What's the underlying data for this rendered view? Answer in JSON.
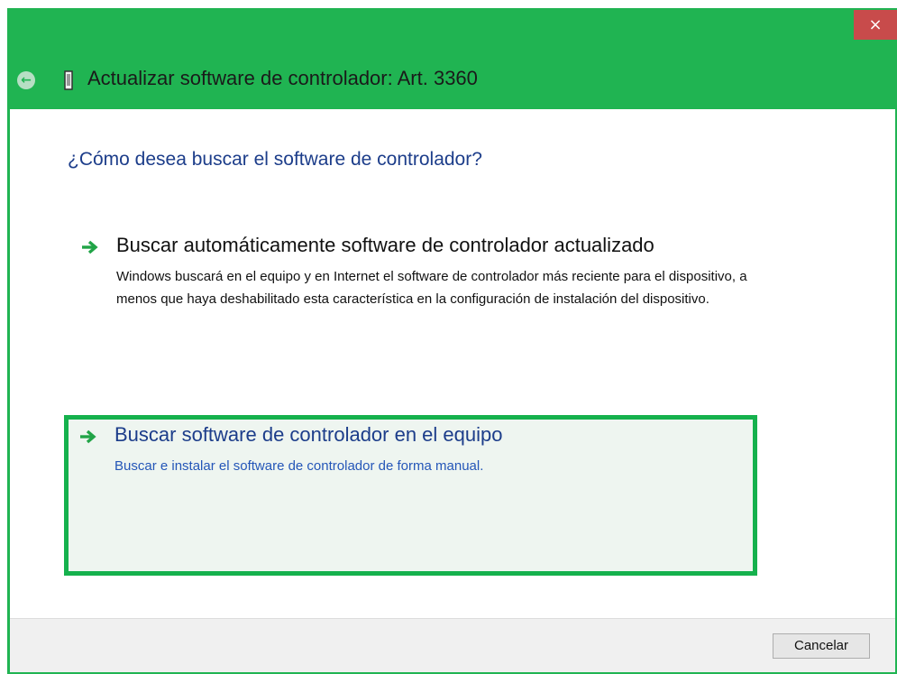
{
  "window": {
    "title": "Actualizar software de controlador: Art. 3360",
    "close_glyph": "×",
    "back_glyph": "←",
    "accent_color": "#20b452",
    "close_color": "#c84b4b"
  },
  "main": {
    "question": "¿Cómo desea buscar el software de controlador?",
    "options": [
      {
        "icon": "green-arrow-icon",
        "heading": "Buscar automáticamente software de controlador actualizado",
        "description": "Windows buscará en el equipo y en Internet el software de controlador más reciente para el dispositivo, a menos que haya deshabilitado esta característica en la configuración de instalación del dispositivo."
      },
      {
        "icon": "green-arrow-icon",
        "heading": "Buscar software de controlador en el equipo",
        "description": "Buscar e instalar el software de controlador de forma manual.",
        "highlighted": true
      }
    ]
  },
  "footer": {
    "cancel_label": "Cancelar"
  }
}
